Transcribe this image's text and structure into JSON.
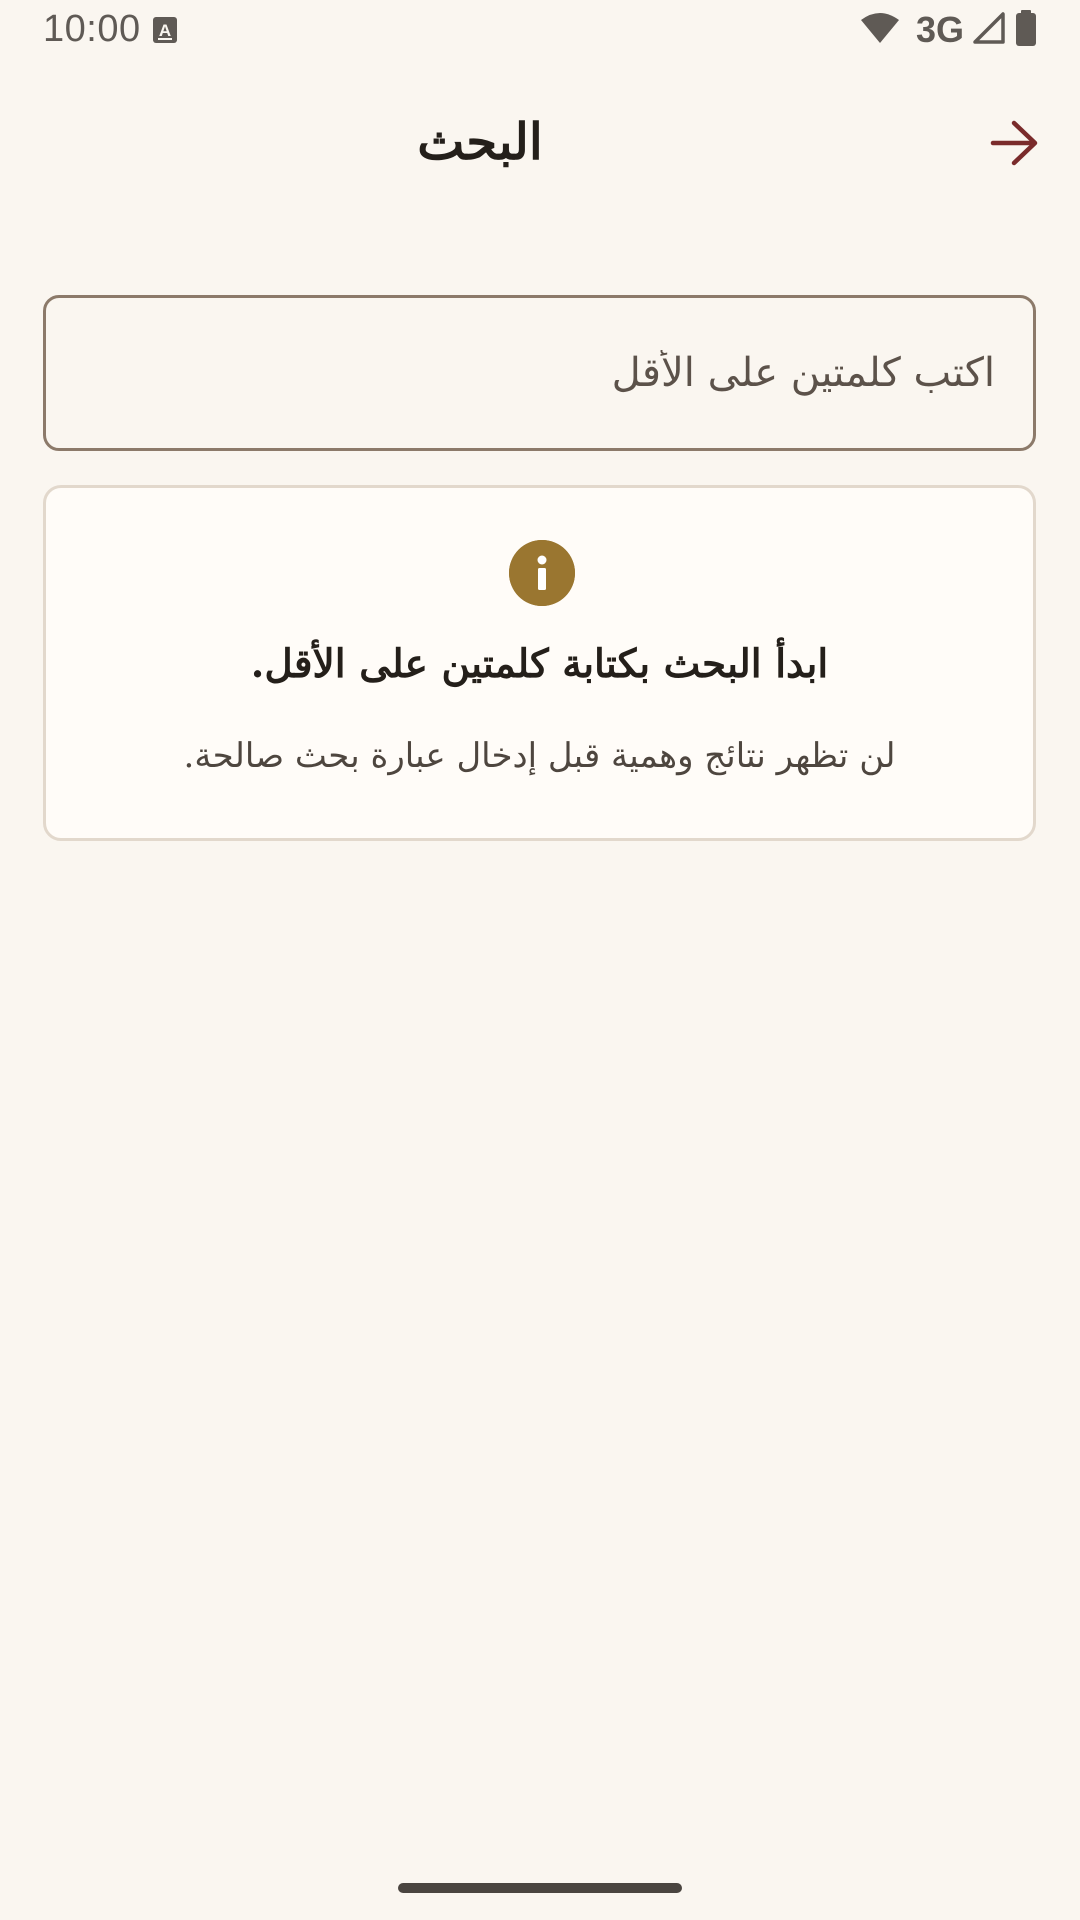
{
  "status_bar": {
    "time": "10:00",
    "network": "3G",
    "icons": [
      "keyboard-a-icon",
      "wifi-icon",
      "signal-icon",
      "battery-icon"
    ]
  },
  "app_bar": {
    "title": "البحث",
    "back_icon": "arrow-forward-icon",
    "back_icon_color": "#7a2b2b"
  },
  "search": {
    "placeholder": "اكتب كلمتين على الأقل",
    "value": ""
  },
  "info_card": {
    "icon": "info-icon",
    "icon_color": "#9a7630",
    "heading": "ابدأ البحث بكتابة كلمتين على الأقل.",
    "subtext": "لن تظهر نتائج وهمية قبل إدخال عبارة بحث صالحة."
  },
  "colors": {
    "background": "#faf6f0",
    "card_background": "#fffcf8",
    "input_border": "#8c7a6a",
    "card_border": "#e2d8cc",
    "accent": "#7a2b2b"
  }
}
